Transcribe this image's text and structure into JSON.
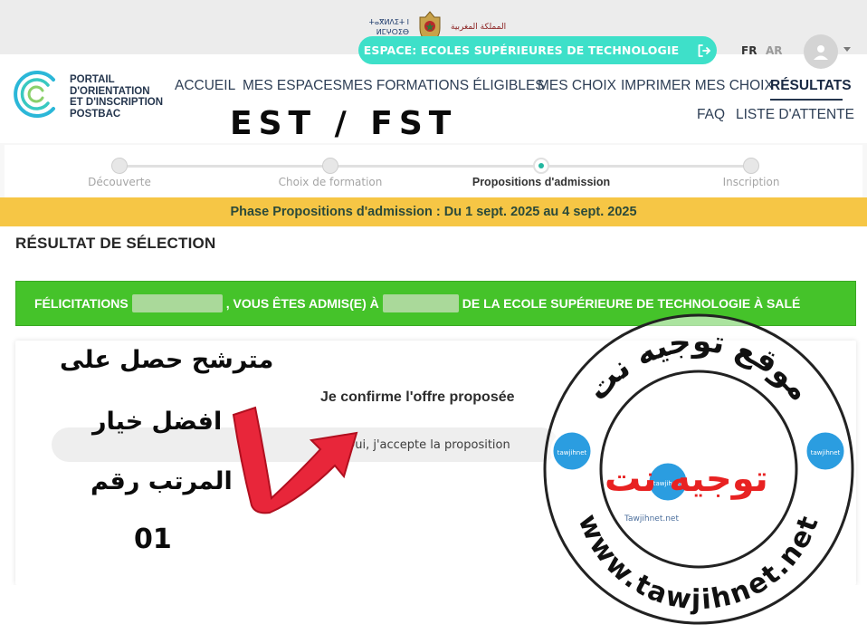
{
  "government": {
    "tifinagh": "ⵜⴰⴳⵍⴷⵉⵜ ⵏ ⵍⵎⵖⵔⵉⴱ",
    "arabic": "المملكة المغربية"
  },
  "espace": {
    "label": "ESPACE: ECOLES SUPÉRIEURES DE TECHNOLOGIE",
    "icon": "logout-icon"
  },
  "languages": [
    {
      "code": "FR",
      "active": true
    },
    {
      "code": "AR",
      "active": false
    }
  ],
  "portal": {
    "name_lines": [
      "PORTAIL",
      "D'ORIENTATION",
      "ET D'INSCRIPTION",
      "POSTBAC"
    ]
  },
  "nav": {
    "row1": [
      "ACCUEIL",
      "MES ESPACES",
      "MES FORMATIONS ÉLIGIBLES",
      "MES CHOIX",
      "IMPRIMER MES CHOIX",
      "RÉSULTATS"
    ],
    "row2": [
      "FAQ",
      "LISTE D'ATTENTE"
    ],
    "active": "RÉSULTATS"
  },
  "overlay_title": "EST / FST",
  "steps": [
    {
      "label": "Découverte",
      "state": "done"
    },
    {
      "label": "Choix de formation",
      "state": "done"
    },
    {
      "label": "Propositions d'admission",
      "state": "current"
    },
    {
      "label": "Inscription",
      "state": "todo"
    }
  ],
  "phase": "Phase Propositions d'admission : Du 1 sept. 2025 au 4 sept. 2025",
  "section_title": "RÉSULTAT DE SÉLECTION",
  "banner": {
    "prefix": "FÉLICITATIONS",
    "middle": ", VOUS ÊTES ADMIS(E) À",
    "suffix": "DE LA ECOLE SUPÉRIEURE DE TECHNOLOGIE À SALÉ",
    "color": "#45c32a"
  },
  "confirm": {
    "title": "Je confirme l'offre proposée",
    "option": "Oui, j'accepte la proposition"
  },
  "annotation": {
    "line1": "مترشح حصل على",
    "line2": "افضل خيار",
    "line3": "المرتب رقم",
    "line4": "01"
  },
  "watermark": {
    "top_arc": "موقع توجيه نت",
    "brand": "توجيه نت",
    "small": "Tawjihnet.net",
    "bottom_arc": "www.tawjihnet.net",
    "badge": "tawjihnet"
  },
  "colors": {
    "accent": "#3ee0c9",
    "phase": "#f6c645",
    "success": "#45c32a",
    "brand_red": "#e82222"
  }
}
